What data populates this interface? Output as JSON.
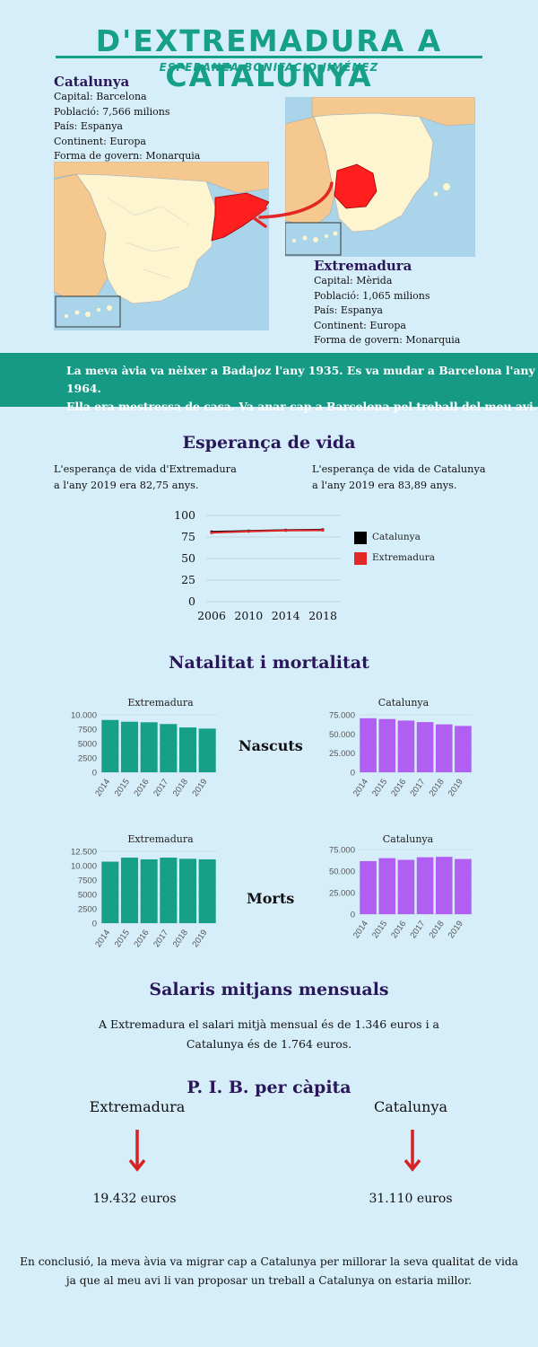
{
  "header": {
    "title": "D'EXTREMADURA A CATALUNYA",
    "author": "ESPERANZA BONIFACIO JIMÉNEZ"
  },
  "catalunya": {
    "name": "Catalunya",
    "lines": [
      "Capital: Barcelona",
      "Població: 7,566 milions",
      "País: Espanya",
      "Continent: Europa",
      "Forma de govern: Monarquia"
    ]
  },
  "extremadura": {
    "name": "Extremadura",
    "lines": [
      "Capital: Mèrida",
      "Població: 1,065 milions",
      "País: Espanya",
      "Continent: Europa",
      "Forma de govern: Monarquia"
    ]
  },
  "banner": {
    "line1": "La meva àvia va nèixer a Badajoz l'any 1935. Es va mudar a Barcelona l'any 1964.",
    "line2": "Ella era mestressa de casa. Va anar cap a Barcelona pel treball del meu avi."
  },
  "life": {
    "title": "Esperança de vida",
    "extremadura_l1": "L'esperança de vida d'Extremadura",
    "extremadura_l2": "a l'any 2019 era 82,75 anys.",
    "catalunya_l1": "L'esperança de vida de Catalunya",
    "catalunya_l2": "a l'any 2019 era 83,89 anys."
  },
  "birth_death": {
    "title": "Natalitat i mortalitat",
    "births_label": "Nascuts",
    "deaths_label": "Morts"
  },
  "salary": {
    "title": "Salaris mitjans mensuals",
    "line1": "A Extremadura el salari mitjà mensual és de 1.346 euros i a",
    "line2": "Catalunya és de 1.764 euros."
  },
  "pib": {
    "title": "P. I. B. per càpita",
    "extremadura_name": "Extremadura",
    "extremadura_value": "19.432 euros",
    "catalunya_name": "Catalunya",
    "catalunya_value": "31.110 euros"
  },
  "conclusion": {
    "line1": "En conclusió, la meva àvia va migrar cap a Catalunya per millorar la seva qualitat de vida",
    "line2": "ja que al meu avi li van proposar un treball a Catalunya on estaria millor."
  },
  "colors": {
    "teal": "#16a08a",
    "purple": "#b15ef2",
    "red": "#e32626",
    "navy": "#2a175a"
  },
  "chart_data": [
    {
      "type": "line",
      "x": [
        2006,
        2010,
        2014,
        2018
      ],
      "xticks": [
        "2006",
        "2010",
        "2014",
        "2018"
      ],
      "yticks": [
        "0",
        "25",
        "50",
        "75",
        "100"
      ],
      "ylim": [
        0,
        100
      ],
      "series": [
        {
          "name": "Catalunya",
          "color": "#000000",
          "values": [
            81,
            82,
            83,
            83.5
          ]
        },
        {
          "name": "Extremadura",
          "color": "#e32626",
          "values": [
            80,
            81.5,
            82.5,
            82.8
          ]
        }
      ]
    },
    {
      "type": "bar",
      "title": "Extremadura",
      "categories": [
        "2014",
        "2015",
        "2016",
        "2017",
        "2018",
        "2019"
      ],
      "values": [
        9100,
        8800,
        8700,
        8400,
        7800,
        7600
      ],
      "ylim": [
        0,
        10000
      ],
      "yticks": [
        "0",
        "2500",
        "5000",
        "7500",
        "10.000"
      ],
      "ytick_values": [
        0,
        2500,
        5000,
        7500,
        10000
      ],
      "color": "#16a08a"
    },
    {
      "type": "bar",
      "title": "Catalunya",
      "categories": [
        "2014",
        "2015",
        "2016",
        "2017",
        "2018",
        "2019"
      ],
      "values": [
        70500,
        69500,
        67500,
        65500,
        62500,
        60500
      ],
      "ylim": [
        0,
        75000
      ],
      "yticks": [
        "0",
        "25.000",
        "50.000",
        "75.000"
      ],
      "ytick_values": [
        0,
        25000,
        50000,
        75000
      ],
      "color": "#b15ef2"
    },
    {
      "type": "bar",
      "title": "Extremadura",
      "categories": [
        "2014",
        "2015",
        "2016",
        "2017",
        "2018",
        "2019"
      ],
      "values": [
        10700,
        11400,
        11100,
        11400,
        11200,
        11100
      ],
      "ylim": [
        0,
        12500
      ],
      "yticks": [
        "0",
        "2500",
        "5000",
        "7500",
        "10.000",
        "12.500"
      ],
      "ytick_values": [
        0,
        2500,
        5000,
        7500,
        10000,
        12500
      ],
      "color": "#16a08a"
    },
    {
      "type": "bar",
      "title": "Catalunya",
      "categories": [
        "2014",
        "2015",
        "2016",
        "2017",
        "2018",
        "2019"
      ],
      "values": [
        61500,
        65000,
        63000,
        66000,
        66500,
        64000
      ],
      "ylim": [
        0,
        75000
      ],
      "yticks": [
        "0",
        "25.000",
        "50.000",
        "75.000"
      ],
      "ytick_values": [
        0,
        25000,
        50000,
        75000
      ],
      "color": "#b15ef2"
    }
  ]
}
